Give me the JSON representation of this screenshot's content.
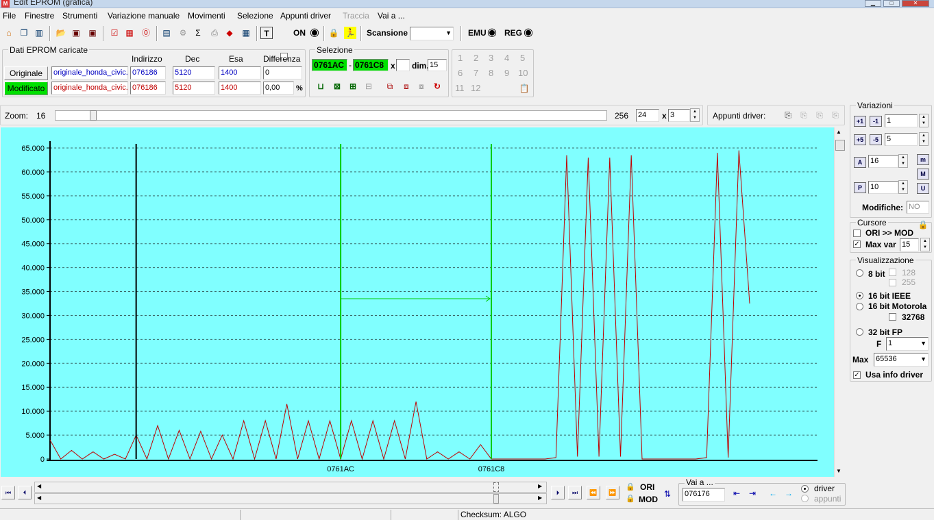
{
  "window": {
    "title": "Edit EPROM (grafica)"
  },
  "menu": [
    "File",
    "Finestre",
    "Strumenti",
    "Variazione manuale",
    "Movimenti",
    "Selezione",
    "Appunti driver",
    "Traccia",
    "Vai a ..."
  ],
  "toolbar": {
    "on_label": "ON",
    "scansione_label": "Scansione",
    "scansione_value": "",
    "emu_label": "EMU",
    "reg_label": "REG"
  },
  "dati": {
    "title": "Dati EPROM caricate",
    "headers": [
      "Indirizzo",
      "Dec",
      "Esa",
      "Differenza"
    ],
    "originale": {
      "label": "Originale",
      "file": "originale_honda_civic.",
      "indirizzo": "076186",
      "dec": "5120",
      "esa": "1400",
      "diff": "0"
    },
    "modificato": {
      "label": "Modificato",
      "file": "originale_honda_civic.",
      "indirizzo": "076186",
      "dec": "5120",
      "esa": "1400",
      "diff": "0,00",
      "pct": "%"
    }
  },
  "selezione": {
    "title": "Selezione",
    "from": "0761AC",
    "dash": "-",
    "to": "0761C8",
    "x": "x",
    "dim_label": "dim.",
    "dim": "15"
  },
  "numpad": [
    "1",
    "2",
    "3",
    "4",
    "5",
    "6",
    "7",
    "8",
    "9",
    "10",
    "11",
    "12"
  ],
  "zoom": {
    "label": "Zoom:",
    "value": "16",
    "max": "256",
    "field1": "24",
    "x": "x",
    "field2": "3",
    "zoom_value": 16
  },
  "appunti": {
    "label": "Appunti driver:"
  },
  "variazioni": {
    "title": "Variazioni",
    "v1": "1",
    "v2": "5",
    "v3": "16",
    "v4": "10",
    "modifiche_label": "Modifiche:",
    "modifiche": "NO"
  },
  "cursore": {
    "title": "Cursore",
    "ori_mod": "ORI >> MOD",
    "max_var_label": "Max var",
    "max_var": "15"
  },
  "visualizzazione": {
    "title": "Visualizzazione",
    "b8": "8 bit",
    "v128": "128",
    "v255": "255",
    "b16ieee": "16 bit IEEE",
    "b16mot": "16 bit Motorola",
    "v32768": "32768",
    "b32": "32 bit FP",
    "f_label": "F",
    "f_value": "1",
    "max_label": "Max",
    "max_value": "65536",
    "usa_info": "Usa info driver"
  },
  "bottom": {
    "ori": "ORI",
    "mod": "MOD",
    "vai_label": "Vai a ...",
    "vai_value": "076176",
    "driver": "driver",
    "appunti": "appunti"
  },
  "status": {
    "checksum": "Checksum: ALGO"
  },
  "colors": {
    "chart_bg": "#80ffff",
    "series": "#c00000",
    "selection": "#00cc00",
    "cursor": "#000000",
    "selected_box": "#00e000"
  },
  "chart_data": {
    "type": "line",
    "ylim": [
      0,
      65000
    ],
    "yticks": [
      "0",
      "5.000",
      "10.000",
      "15.000",
      "20.000",
      "25.000",
      "30.000",
      "35.000",
      "40.000",
      "45.000",
      "50.000",
      "55.000",
      "60.000",
      "65.000"
    ],
    "ytick_values": [
      0,
      5000,
      10000,
      15000,
      20000,
      25000,
      30000,
      35000,
      40000,
      45000,
      50000,
      55000,
      60000,
      65000
    ],
    "grid": true,
    "selection": {
      "start_label": "0761AC",
      "end_label": "0761C8",
      "start_index": 27,
      "end_index": 41
    },
    "cursor_index": 8,
    "xlim": [
      0,
      71.3
    ],
    "values": [
      4000,
      0,
      1800,
      0,
      1500,
      0,
      1000,
      0,
      5000,
      0,
      7000,
      0,
      6000,
      0,
      5800,
      0,
      5000,
      0,
      8000,
      0,
      8000,
      0,
      11500,
      0,
      8000,
      0,
      8000,
      0,
      8000,
      0,
      8000,
      0,
      8000,
      0,
      12000,
      0,
      1500,
      0,
      1500,
      0,
      3000,
      0,
      0,
      0,
      0,
      0,
      0,
      300,
      63500,
      500,
      63000,
      500,
      63000,
      500,
      63500,
      0,
      0,
      0,
      0,
      0,
      0,
      300,
      64000,
      300,
      64500,
      32500
    ]
  }
}
